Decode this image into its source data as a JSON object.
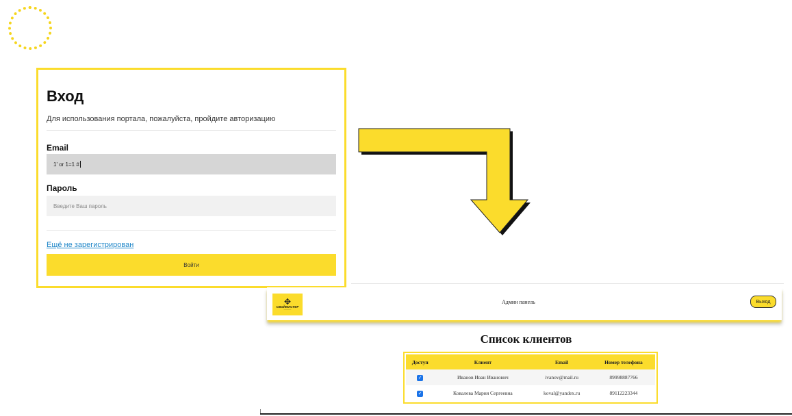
{
  "login": {
    "title": "Вход",
    "subtitle": "Для использования портала, пожалуйста, пройдите авторизацию",
    "email_label": "Email",
    "email_value": "1' or 1=1 #",
    "password_label": "Пароль",
    "password_placeholder": "Введите Ваш пароль",
    "register_link": "Ещё не зарегистрирован",
    "submit_label": "Войти"
  },
  "admin": {
    "logo_text": "СВОЙМАСТЕР",
    "nav_title": "Админ панель",
    "exit_label": "Выход",
    "list_title": "Список клиентов",
    "columns": [
      "Доступ",
      "Клиент",
      "Email",
      "Номер телефона"
    ],
    "rows": [
      {
        "access": true,
        "client": "Иванов Иван Иванович",
        "email": "ivanov@mail.ru",
        "phone": "89998887766"
      },
      {
        "access": true,
        "client": "Ковалева Мария Сергеевна",
        "email": "koval@yandex.ru",
        "phone": "89112223344"
      }
    ]
  },
  "colors": {
    "accent": "#fbdc2c",
    "link": "#1f86c8",
    "checkbox": "#1a73e8"
  },
  "icons": {
    "arrow": "bent-arrow-down-icon",
    "ring": "dotted-circle-icon",
    "logo": "wrench-logo-icon"
  }
}
